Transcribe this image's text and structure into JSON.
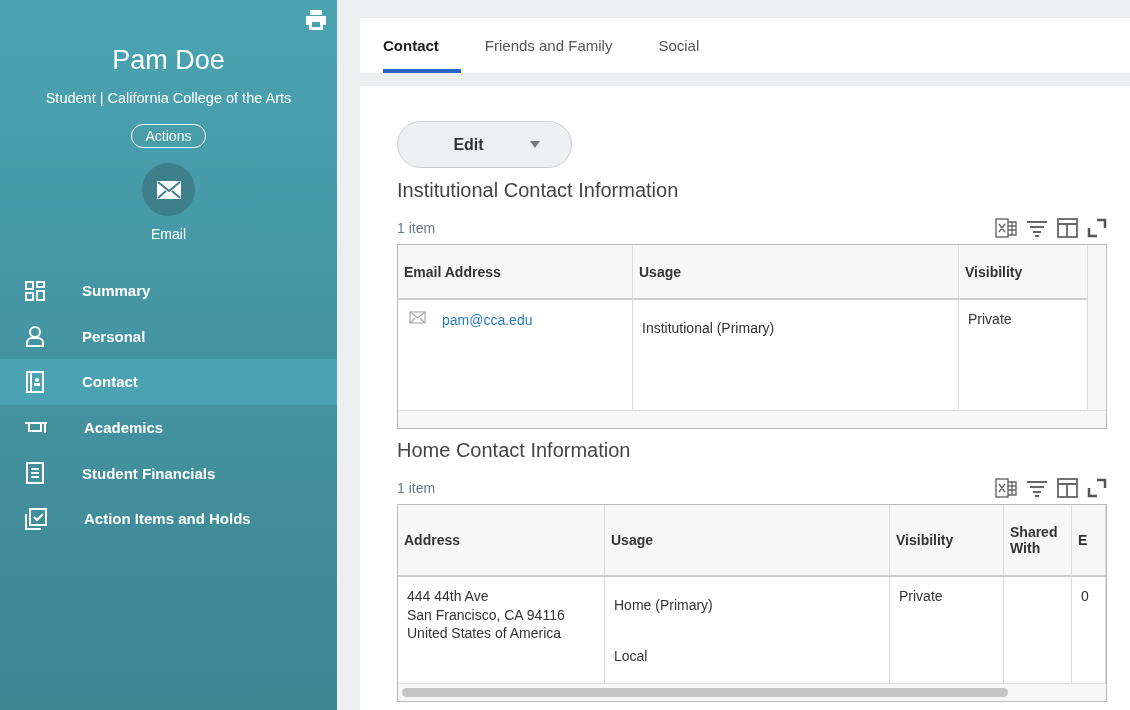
{
  "profile": {
    "name": "Pam Doe",
    "subtitle": "Student | California College of the Arts",
    "actions_button": "Actions",
    "quick_action": "Email"
  },
  "nav": [
    {
      "label": "Summary",
      "selected": false
    },
    {
      "label": "Personal",
      "selected": false
    },
    {
      "label": "Contact",
      "selected": true
    },
    {
      "label": "Academics",
      "selected": false
    },
    {
      "label": "Student Financials",
      "selected": false
    },
    {
      "label": "Action Items and Holds",
      "selected": false
    }
  ],
  "tabs": [
    {
      "label": "Contact",
      "selected": true
    },
    {
      "label": "Friends and Family",
      "selected": false
    },
    {
      "label": "Social",
      "selected": false
    }
  ],
  "edit_button": "Edit",
  "sections": [
    {
      "title": "Institutional Contact Information",
      "count": "1 item",
      "columns": [
        {
          "label": "Email Address"
        },
        {
          "label": "Usage"
        },
        {
          "label": "Visibility"
        }
      ],
      "rows": [
        [
          {
            "kind": "email",
            "lines": [
              "pam@cca.edu"
            ]
          },
          {
            "kind": "text",
            "lines": [
              "Institutional (Primary)"
            ]
          },
          {
            "kind": "text",
            "lines": [
              "Private"
            ]
          }
        ]
      ],
      "scrollbar": false
    },
    {
      "title": "Home Contact Information",
      "count": "1 item",
      "columns": [
        {
          "label": "Address"
        },
        {
          "label": "Usage"
        },
        {
          "label": "Visibility"
        },
        {
          "label": "Shared With"
        },
        {
          "label": "E"
        }
      ],
      "rows": [
        [
          {
            "kind": "text",
            "lines": [
              "444 44th Ave",
              "San Francisco, CA 94116",
              "United States of America"
            ]
          },
          {
            "kind": "text",
            "lines": [
              "Home (Primary)",
              "Local"
            ]
          },
          {
            "kind": "text",
            "lines": [
              "Private"
            ]
          },
          {
            "kind": "empty"
          },
          {
            "kind": "text",
            "lines": [
              "0"
            ]
          }
        ]
      ],
      "scrollbar": true
    }
  ]
}
